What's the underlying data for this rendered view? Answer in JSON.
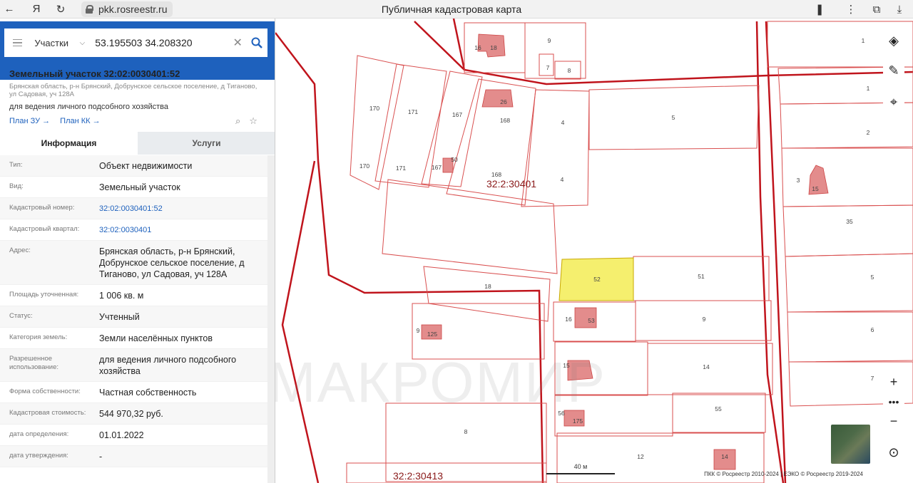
{
  "browser": {
    "url": "pkk.rosreestr.ru",
    "title": "Публичная кадастровая карта"
  },
  "search": {
    "type_label": "Участки",
    "query": "53.195503 34.208320"
  },
  "parcel": {
    "title": "Земельный участок 32:02:0030401:52",
    "address": "Брянская область, р-н Брянский, Добрунское сельское поселение, д Тиганово, ул Садовая, уч 128А",
    "purpose": "для ведения личного подсобного хозяйства",
    "plan_zu": "План ЗУ",
    "plan_kk": "План КК"
  },
  "tabs": {
    "info": "Информация",
    "services": "Услуги"
  },
  "info_rows": [
    {
      "key": "Тип:",
      "value": "Объект недвижимости"
    },
    {
      "key": "Вид:",
      "value": "Земельный участок"
    },
    {
      "key": "Кадастровый номер:",
      "value": "32:02:0030401:52"
    },
    {
      "key": "Кадастровый квартал:",
      "value": "32:02:0030401"
    },
    {
      "key": "Адрес:",
      "value": "Брянская область, р-н Брянский, Добрунское сельское поселение, д Тиганово, ул Садовая, уч 128А"
    },
    {
      "key": "Площадь уточненная:",
      "value": "1 006 кв. м"
    },
    {
      "key": "Статус:",
      "value": "Учтенный"
    },
    {
      "key": "Категория земель:",
      "value": "Земли населённых пунктов"
    },
    {
      "key": "Разрешенное использование:",
      "value": "для ведения личного подсобного хозяйства"
    },
    {
      "key": "Форма собственности:",
      "value": "Частная собственность"
    },
    {
      "key": "Кадастровая стоимость:",
      "value": "544 970,32 руб."
    },
    {
      "key": "дата определения:",
      "value": "01.01.2022"
    },
    {
      "key": "дата утверждения:",
      "value": "-"
    }
  ],
  "map": {
    "quarter_1": "32:2:30401",
    "quarter_2": "32:2:30413",
    "scale": "40 м",
    "attribution": "ПКК © Росреестр 2010-2024 | ЕЭКО © Росреестр 2019-2024",
    "watermark": "МАКРОМИР",
    "labels": [
      "9",
      "16",
      "18",
      "7",
      "8",
      "1",
      "170",
      "171",
      "167",
      "26",
      "168",
      "5",
      "4",
      "170",
      "171",
      "167",
      "50",
      "168",
      "4",
      "2",
      "3",
      "15",
      "1",
      "35",
      "52",
      "51",
      "5",
      "18",
      "16",
      "53",
      "9",
      "6",
      "9",
      "125",
      "15",
      "14",
      "7",
      "56",
      "175",
      "55",
      "8",
      "12",
      "14"
    ],
    "selected_color": "#f5ef6e"
  }
}
